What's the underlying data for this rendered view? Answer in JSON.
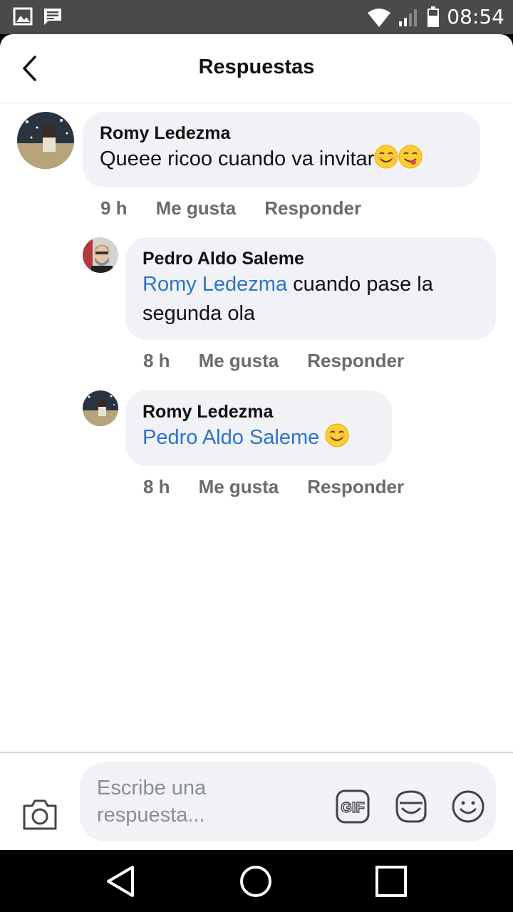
{
  "status_bar": {
    "time": "08:54",
    "icons": [
      "image-icon",
      "message-icon",
      "wifi-icon",
      "signal-icon",
      "battery-icon"
    ]
  },
  "header": {
    "title": "Respuestas",
    "back_icon": "chevron-left-icon"
  },
  "comments": [
    {
      "author": "Romy Ledezma",
      "text": "Queee ricoo cuando va invitar",
      "emojis": [
        "smiling-face-icon",
        "yum-face-icon"
      ],
      "time": "9 h",
      "like_label": "Me gusta",
      "reply_label": "Responder"
    },
    {
      "author": "Pedro Aldo Saleme",
      "mention": "Romy Ledezma",
      "text_line1": " cuando pase la",
      "text_line2": "segunda ola",
      "time": "8 h",
      "like_label": "Me gusta",
      "reply_label": "Responder"
    },
    {
      "author": "Romy Ledezma",
      "mention": "Pedro Aldo Saleme",
      "emojis": [
        "smiling-face-icon"
      ],
      "time": "8 h",
      "like_label": "Me gusta",
      "reply_label": "Responder"
    }
  ],
  "composer": {
    "placeholder": "Escribe una respuesta...",
    "icons": [
      "camera-icon",
      "gif-icon",
      "sticker-icon",
      "emoji-icon"
    ]
  },
  "nav_bar": {
    "icons": [
      "back-triangle-icon",
      "home-circle-icon",
      "recents-square-icon"
    ]
  },
  "colors": {
    "mention": "#2d74c9",
    "bubble": "#f0f2f5",
    "meta_text": "#6b6b6b",
    "status_bar": "#4a4a4a"
  }
}
